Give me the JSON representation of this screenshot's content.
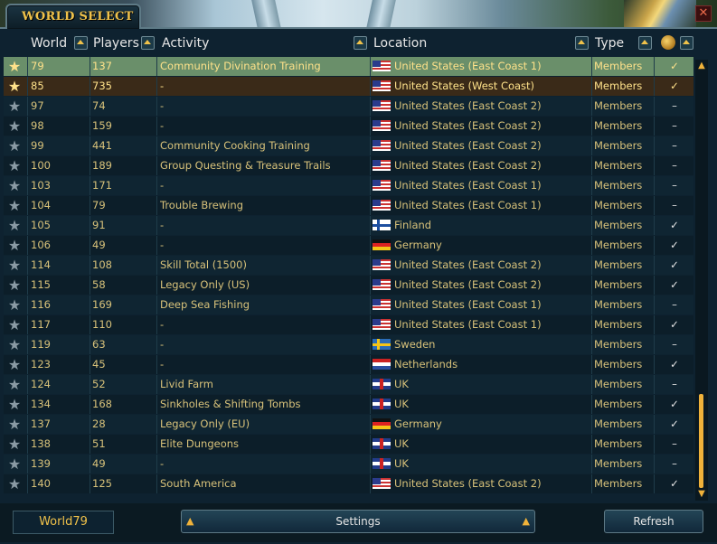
{
  "window": {
    "title": "WORLD SELECT",
    "close_label": "✕"
  },
  "header": {
    "world": "World",
    "players": "Players",
    "activity": "Activity",
    "location": "Location",
    "type": "Type"
  },
  "colors": {
    "accent": "#f0c24a",
    "favorite_row": "#6a8f6a",
    "favorite_row_2": "#3a2a18"
  },
  "rows": [
    {
      "star": "★",
      "world": "79",
      "players": "137",
      "activity": "Community Divination Training",
      "flag": "us",
      "location": "United States (East Coast 1)",
      "type": "Members",
      "lootshare": "✓",
      "fav": 1
    },
    {
      "star": "★",
      "world": "85",
      "players": "735",
      "activity": "-",
      "flag": "us",
      "location": "United States (West Coast)",
      "type": "Members",
      "lootshare": "✓",
      "fav": 2
    },
    {
      "star": "★",
      "world": "97",
      "players": "74",
      "activity": "-",
      "flag": "us",
      "location": "United States (East Coast 2)",
      "type": "Members",
      "lootshare": "–"
    },
    {
      "star": "★",
      "world": "98",
      "players": "159",
      "activity": "-",
      "flag": "us",
      "location": "United States (East Coast 2)",
      "type": "Members",
      "lootshare": "–"
    },
    {
      "star": "★",
      "world": "99",
      "players": "441",
      "activity": "Community Cooking Training",
      "flag": "us",
      "location": "United States (East Coast 2)",
      "type": "Members",
      "lootshare": "–"
    },
    {
      "star": "★",
      "world": "100",
      "players": "189",
      "activity": "Group Questing & Treasure Trails",
      "flag": "us",
      "location": "United States (East Coast 2)",
      "type": "Members",
      "lootshare": "–"
    },
    {
      "star": "★",
      "world": "103",
      "players": "171",
      "activity": "-",
      "flag": "us",
      "location": "United States (East Coast 1)",
      "type": "Members",
      "lootshare": "–"
    },
    {
      "star": "★",
      "world": "104",
      "players": "79",
      "activity": "Trouble Brewing",
      "flag": "us",
      "location": "United States (East Coast 1)",
      "type": "Members",
      "lootshare": "–"
    },
    {
      "star": "★",
      "world": "105",
      "players": "91",
      "activity": "-",
      "flag": "fi",
      "location": "Finland",
      "type": "Members",
      "lootshare": "✓"
    },
    {
      "star": "★",
      "world": "106",
      "players": "49",
      "activity": "-",
      "flag": "de",
      "location": "Germany",
      "type": "Members",
      "lootshare": "✓"
    },
    {
      "star": "★",
      "world": "114",
      "players": "108",
      "activity": "Skill Total (1500)",
      "flag": "us",
      "location": "United States (East Coast 2)",
      "type": "Members",
      "lootshare": "✓"
    },
    {
      "star": "★",
      "world": "115",
      "players": "58",
      "activity": "Legacy Only (US)",
      "flag": "us",
      "location": "United States (East Coast 2)",
      "type": "Members",
      "lootshare": "✓"
    },
    {
      "star": "★",
      "world": "116",
      "players": "169",
      "activity": "Deep Sea Fishing",
      "flag": "us",
      "location": "United States (East Coast 1)",
      "type": "Members",
      "lootshare": "–"
    },
    {
      "star": "★",
      "world": "117",
      "players": "110",
      "activity": "-",
      "flag": "us",
      "location": "United States (East Coast 1)",
      "type": "Members",
      "lootshare": "✓"
    },
    {
      "star": "★",
      "world": "119",
      "players": "63",
      "activity": "-",
      "flag": "se",
      "location": "Sweden",
      "type": "Members",
      "lootshare": "–"
    },
    {
      "star": "★",
      "world": "123",
      "players": "45",
      "activity": "-",
      "flag": "nl",
      "location": "Netherlands",
      "type": "Members",
      "lootshare": "✓"
    },
    {
      "star": "★",
      "world": "124",
      "players": "52",
      "activity": "Livid Farm",
      "flag": "uk",
      "location": "UK",
      "type": "Members",
      "lootshare": "–"
    },
    {
      "star": "★",
      "world": "134",
      "players": "168",
      "activity": "Sinkholes & Shifting Tombs",
      "flag": "uk",
      "location": "UK",
      "type": "Members",
      "lootshare": "✓"
    },
    {
      "star": "★",
      "world": "137",
      "players": "28",
      "activity": "Legacy Only (EU)",
      "flag": "de",
      "location": "Germany",
      "type": "Members",
      "lootshare": "✓"
    },
    {
      "star": "★",
      "world": "138",
      "players": "51",
      "activity": "Elite Dungeons",
      "flag": "uk",
      "location": "UK",
      "type": "Members",
      "lootshare": "–"
    },
    {
      "star": "★",
      "world": "139",
      "players": "49",
      "activity": "-",
      "flag": "uk",
      "location": "UK",
      "type": "Members",
      "lootshare": "–"
    },
    {
      "star": "★",
      "world": "140",
      "players": "125",
      "activity": "South America",
      "flag": "us",
      "location": "United States (East Coast 2)",
      "type": "Members",
      "lootshare": "✓"
    }
  ],
  "footer": {
    "current_world": "World79",
    "settings_label": "Settings",
    "refresh_label": "Refresh"
  },
  "scrollbar": {
    "up": "▲",
    "down": "▼"
  },
  "icons": {
    "sort": "sort-arrow-icon",
    "lootshare": "coin-pouch-icon",
    "favorite": "star-icon"
  }
}
